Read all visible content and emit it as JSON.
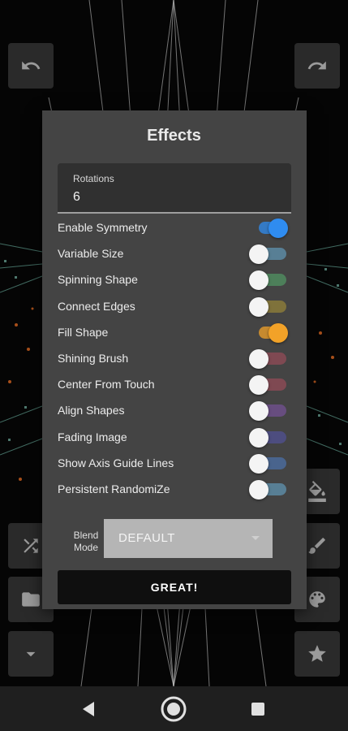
{
  "dialog": {
    "title": "Effects",
    "rotations": {
      "label": "Rotations",
      "value": "6"
    },
    "toggles": [
      {
        "label": "Enable Symmetry",
        "on": true,
        "color": "#2f8cf0"
      },
      {
        "label": "Variable Size",
        "on": false,
        "color": "#5c8aa3"
      },
      {
        "label": "Spinning Shape",
        "on": false,
        "color": "#4f8a5e"
      },
      {
        "label": "Connect Edges",
        "on": false,
        "color": "#8a7a3a"
      },
      {
        "label": "Fill Shape",
        "on": true,
        "color": "#f2a228"
      },
      {
        "label": "Shining Brush",
        "on": false,
        "color": "#8a4a55"
      },
      {
        "label": "Center From Touch",
        "on": false,
        "color": "#8a4a55"
      },
      {
        "label": "Align Shapes",
        "on": false,
        "color": "#6d4f8a"
      },
      {
        "label": "Fading Image",
        "on": false,
        "color": "#4f4f8a"
      },
      {
        "label": "Show Axis Guide Lines",
        "on": false,
        "color": "#4a6a9a"
      },
      {
        "label": "Persistent RandomiZe",
        "on": false,
        "color": "#5c8aa3"
      }
    ],
    "blend": {
      "label_line1": "Blend",
      "label_line2": "Mode",
      "value": "DEFAULT"
    },
    "great_label": "GREAT!"
  },
  "icons": {
    "undo": "undo-icon",
    "redo": "redo-icon",
    "shuffle": "shuffle-icon",
    "folder": "folder-icon",
    "chevron": "chevron-down-icon",
    "fill": "paint-bucket-icon",
    "brush": "brush-icon",
    "palette": "palette-icon",
    "star": "star-icon"
  },
  "nav": {
    "back": "back-icon",
    "home": "home-icon",
    "recents": "recents-icon"
  }
}
